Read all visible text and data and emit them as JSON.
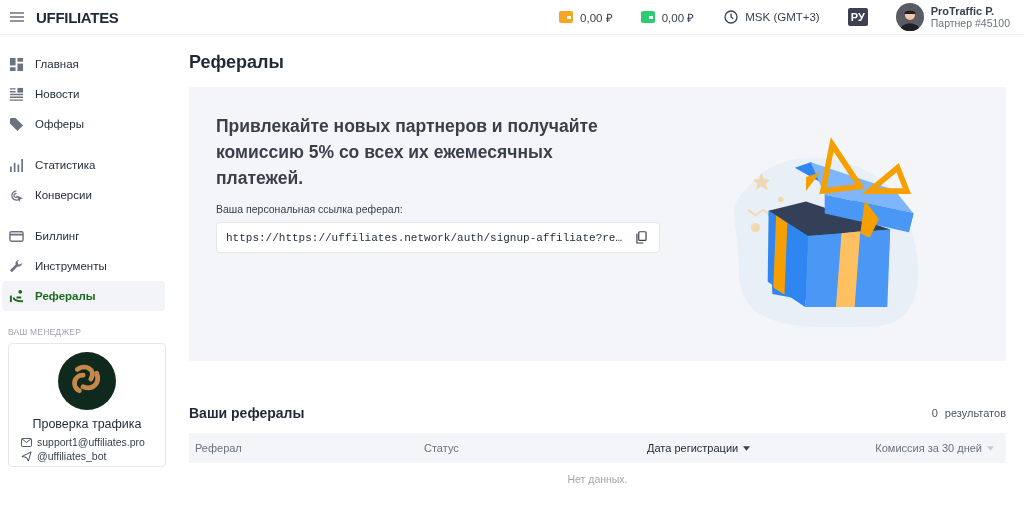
{
  "header": {
    "logo": "UFFILIATES",
    "balances": [
      {
        "amount": "0,00 ₽",
        "color": "#f5a623"
      },
      {
        "amount": "0,00 ₽",
        "color": "#2ecc71"
      }
    ],
    "timezone": "MSK (GMT+3)",
    "language": "РУ",
    "user": {
      "name": "ProTraffic P.",
      "partner": "Партнер #45100"
    }
  },
  "sidebar": {
    "groups": [
      [
        {
          "label": "Главная",
          "selected": false
        },
        {
          "label": "Новости",
          "selected": false
        },
        {
          "label": "Офферы",
          "selected": false
        }
      ],
      [
        {
          "label": "Статистика",
          "selected": false
        },
        {
          "label": "Конверсии",
          "selected": false
        }
      ],
      [
        {
          "label": "Биллинг",
          "selected": false
        },
        {
          "label": "Инструменты",
          "selected": false
        },
        {
          "label": "Рефералы",
          "selected": true
        }
      ]
    ],
    "manager": {
      "heading": "ВАШ МЕНЕДЖЕР",
      "name": "Проверка трафика",
      "email": "support1@uffiliates.pro",
      "telegram": "@uffiliates_bot"
    }
  },
  "page": {
    "title": "Рефералы",
    "promo": {
      "headline": "Привлекайте новых партнеров и получайте комиссию 5% со всех их ежемесячных платежей.",
      "link_label": "Ваша персональная ссылка реферал:",
      "link": "https://https://uffiliates.network/auth/signup-affiliate?re…"
    },
    "referrals": {
      "title": "Ваши рефералы",
      "count": "0",
      "count_label": "результатов",
      "columns": [
        {
          "label": "Реферал",
          "sorted": false,
          "sortable": false
        },
        {
          "label": "Статус",
          "sorted": false,
          "sortable": false
        },
        {
          "label": "Дата регистрации",
          "sorted": true,
          "sortable": true
        },
        {
          "label": "Комиссия за 30 дней",
          "sorted": false,
          "sortable": true
        }
      ],
      "empty": "Нет данных."
    }
  }
}
